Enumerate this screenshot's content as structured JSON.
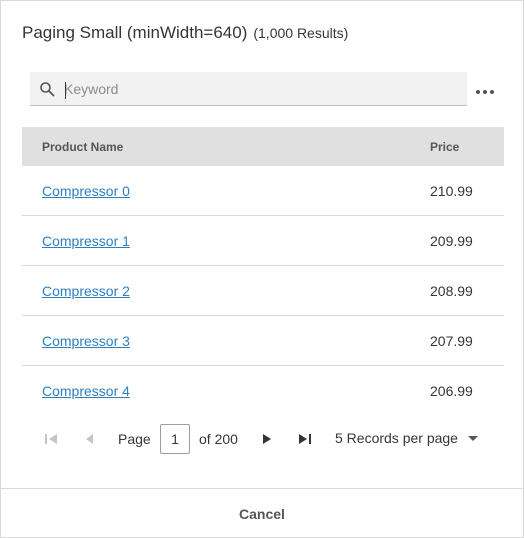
{
  "dialog": {
    "title": "Paging Small (minWidth=640)",
    "result_count": "(1,000 Results)"
  },
  "search": {
    "placeholder": "Keyword",
    "value": "",
    "icon": "search-icon"
  },
  "more_menu": {
    "icon": "more-horizontal-icon"
  },
  "table": {
    "columns": [
      "Product Name",
      "Price"
    ],
    "rows": [
      {
        "name": "Compressor 0",
        "price": "210.99"
      },
      {
        "name": "Compressor 1",
        "price": "209.99"
      },
      {
        "name": "Compressor 2",
        "price": "208.99"
      },
      {
        "name": "Compressor 3",
        "price": "207.99"
      },
      {
        "name": "Compressor 4",
        "price": "206.99"
      }
    ]
  },
  "pager": {
    "page_label": "Page",
    "current_page": "1",
    "of_label": "of 200",
    "records_per_page": "5 Records per page"
  },
  "footer": {
    "cancel_label": "Cancel"
  },
  "colors": {
    "link": "#2b7fc3",
    "header_bg": "#e0e0e0",
    "search_bg": "#f2f2f2"
  }
}
